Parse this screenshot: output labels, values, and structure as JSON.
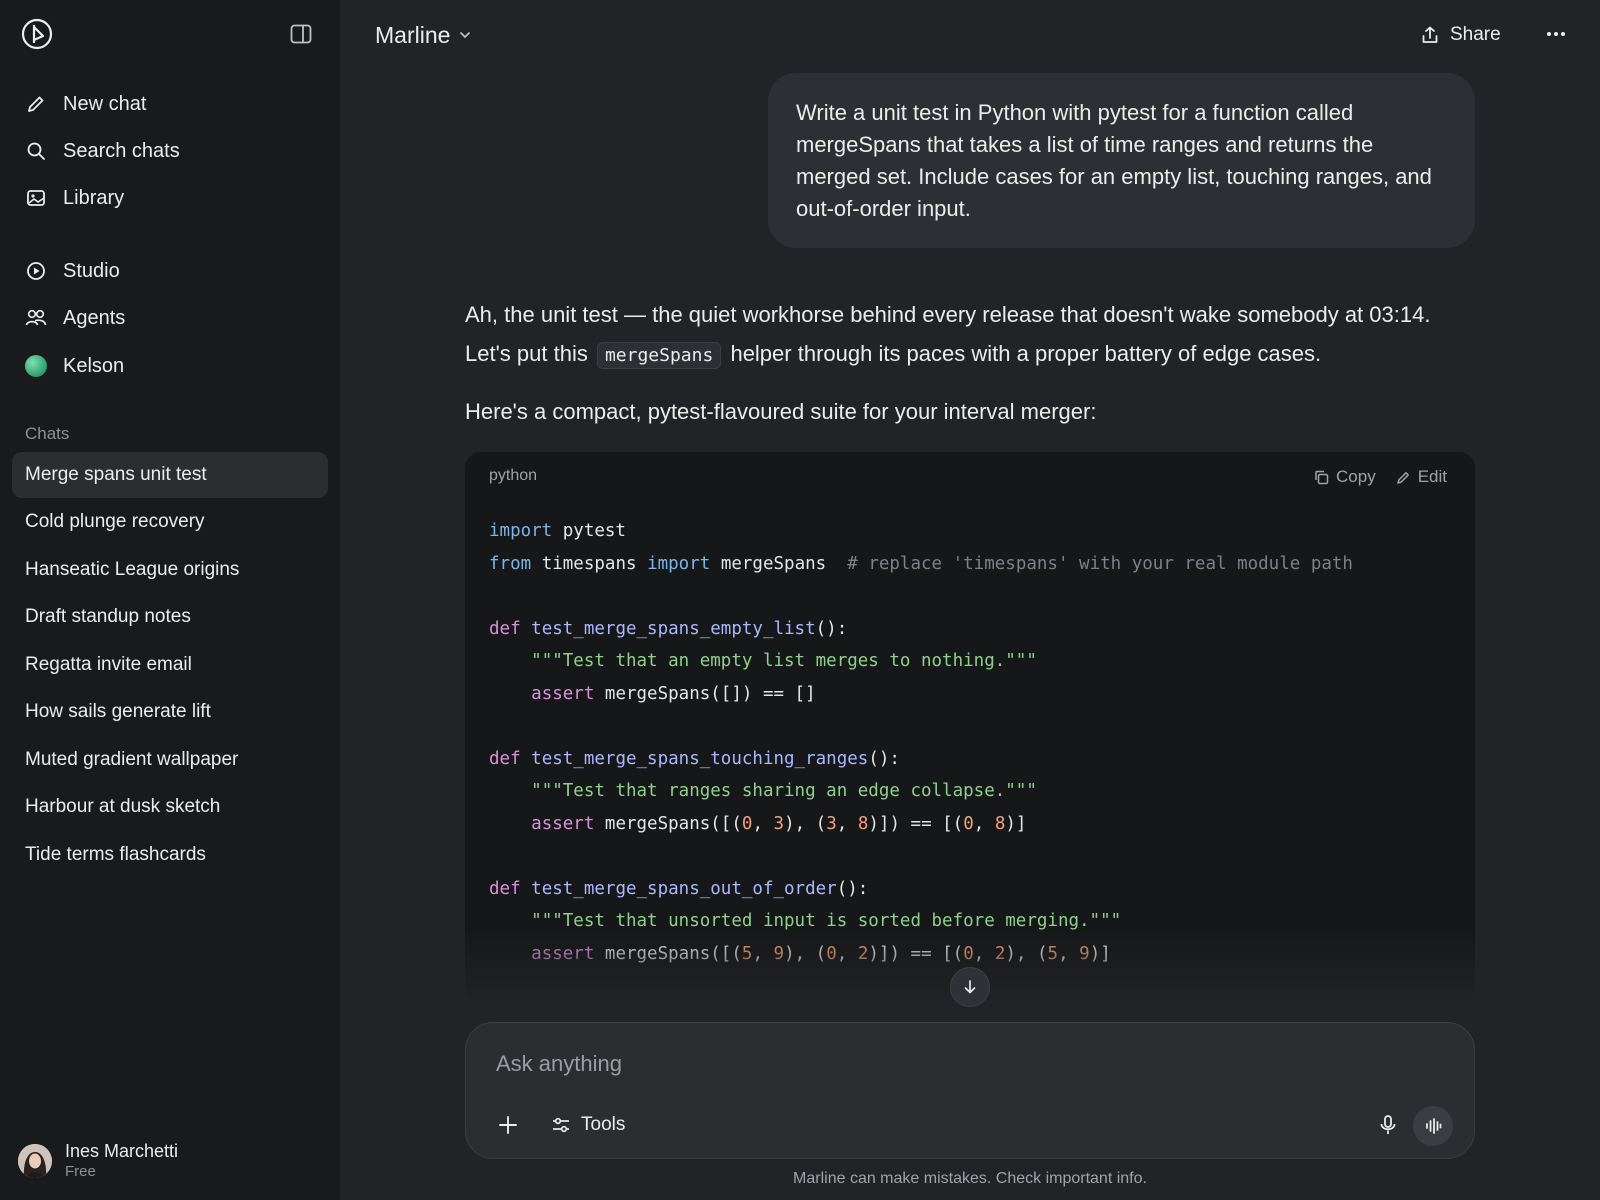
{
  "sidebar": {
    "nav": [
      {
        "label": "New chat",
        "icon": "pencil-icon"
      },
      {
        "label": "Search chats",
        "icon": "search-icon"
      },
      {
        "label": "Library",
        "icon": "image-icon"
      }
    ],
    "nav2": [
      {
        "label": "Studio",
        "icon": "play-circle-icon"
      },
      {
        "label": "Agents",
        "icon": "users-icon"
      },
      {
        "label": "Kelson",
        "icon": "green-orb-icon"
      }
    ],
    "section_label": "Chats",
    "chats": [
      {
        "label": "Merge spans unit test",
        "active": true
      },
      {
        "label": "Cold plunge recovery"
      },
      {
        "label": "Hanseatic League origins"
      },
      {
        "label": "Draft standup notes"
      },
      {
        "label": "Regatta invite email"
      },
      {
        "label": "How sails generate lift"
      },
      {
        "label": "Muted gradient wallpaper"
      },
      {
        "label": "Harbour at dusk sketch"
      },
      {
        "label": "Tide terms flashcards"
      }
    ],
    "user": {
      "name": "Ines Marchetti",
      "plan": "Free"
    }
  },
  "header": {
    "model_name": "Marline",
    "share_label": "Share"
  },
  "conversation": {
    "user_message": "Write a unit test in Python with pytest for a function called mergeSpans that takes a list of time ranges and returns the merged set. Include cases for an empty list, touching ranges, and out-of-order input.",
    "assistant": {
      "p1_before": "Ah, the unit test — the quiet workhorse behind every release that doesn't wake somebody at 03:14. Let's put this",
      "p1_code": "mergeSpans",
      "p1_after": "helper through its paces with a proper battery of edge cases.",
      "p2": "Here's a compact, pytest-flavoured suite for your interval merger:"
    },
    "code_block": {
      "language": "python",
      "copy_label": "Copy",
      "edit_label": "Edit",
      "lines": [
        [
          [
            "kw",
            "import"
          ],
          [
            "t",
            " pytest"
          ]
        ],
        [
          [
            "kw",
            "from"
          ],
          [
            "t",
            " timespans "
          ],
          [
            "kw",
            "import"
          ],
          [
            "t",
            " mergeSpans  "
          ],
          [
            "cmt",
            "# replace 'timespans' with your real module path"
          ]
        ],
        [],
        [
          [
            "kw2",
            "def"
          ],
          [
            "t",
            " "
          ],
          [
            "fn",
            "test_merge_spans_empty_list"
          ],
          [
            "t",
            "():"
          ]
        ],
        [
          [
            "t",
            "    "
          ],
          [
            "str",
            "\"\"\"Test that an empty list merges to nothing.\"\"\""
          ]
        ],
        [
          [
            "t",
            "    "
          ],
          [
            "kw2",
            "assert"
          ],
          [
            "t",
            " mergeSpans([]) == []"
          ]
        ],
        [],
        [
          [
            "kw2",
            "def"
          ],
          [
            "t",
            " "
          ],
          [
            "fn",
            "test_merge_spans_touching_ranges"
          ],
          [
            "t",
            "():"
          ]
        ],
        [
          [
            "t",
            "    "
          ],
          [
            "str",
            "\"\"\"Test that ranges sharing an edge collapse.\"\"\""
          ]
        ],
        [
          [
            "t",
            "    "
          ],
          [
            "kw2",
            "assert"
          ],
          [
            "t",
            " mergeSpans([("
          ],
          [
            "num",
            "0"
          ],
          [
            "t",
            ", "
          ],
          [
            "num",
            "3"
          ],
          [
            "t",
            "), ("
          ],
          [
            "num",
            "3"
          ],
          [
            "t",
            ", "
          ],
          [
            "num",
            "8"
          ],
          [
            "t",
            ")]) == [("
          ],
          [
            "num",
            "0"
          ],
          [
            "t",
            ", "
          ],
          [
            "num",
            "8"
          ],
          [
            "t",
            ")]"
          ]
        ],
        [],
        [
          [
            "kw2",
            "def"
          ],
          [
            "t",
            " "
          ],
          [
            "fn",
            "test_merge_spans_out_of_order"
          ],
          [
            "t",
            "():"
          ]
        ],
        [
          [
            "t",
            "    "
          ],
          [
            "str",
            "\"\"\"Test that unsorted input is sorted before merging.\"\"\""
          ]
        ],
        [
          [
            "t",
            "    "
          ],
          [
            "kw2",
            "assert"
          ],
          [
            "t",
            " mergeSpans([("
          ],
          [
            "num",
            "5"
          ],
          [
            "t",
            ", "
          ],
          [
            "num",
            "9"
          ],
          [
            "t",
            "), ("
          ],
          [
            "num",
            "0"
          ],
          [
            "t",
            ", "
          ],
          [
            "num",
            "2"
          ],
          [
            "t",
            ")]) == [("
          ],
          [
            "num",
            "0"
          ],
          [
            "t",
            ", "
          ],
          [
            "num",
            "2"
          ],
          [
            "t",
            "), ("
          ],
          [
            "num",
            "5"
          ],
          [
            "t",
            ", "
          ],
          [
            "num",
            "9"
          ],
          [
            "t",
            ")]"
          ]
        ]
      ]
    }
  },
  "composer": {
    "placeholder": "Ask anything",
    "tools_label": "Tools"
  },
  "disclaimer": "Marline can make mistakes. Check important info."
}
